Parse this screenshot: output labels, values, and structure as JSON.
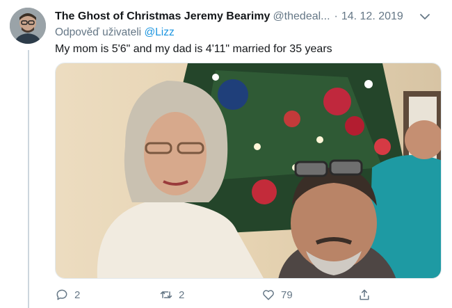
{
  "tweet": {
    "author_name": "The Ghost of Christmas Jeremy Bearimy",
    "handle": "@thedeal...",
    "separator": "·",
    "date": "14. 12. 2019",
    "reply_prefix": "Odpověď uživateli",
    "reply_to": "@Lizz",
    "text": "My mom is 5'6\" and my dad is 4'11\" married for 35 years",
    "photo_description": "Couple posing in front of a decorated Christmas tree"
  },
  "actions": {
    "reply_count": "2",
    "retweet_count": "2",
    "like_count": "79"
  },
  "colors": {
    "secondary_text": "#657786",
    "link": "#1b95e0",
    "thread_line": "#ccd6dd"
  },
  "icons": [
    "chevron-down-icon",
    "reply-icon",
    "retweet-icon",
    "like-icon",
    "share-icon"
  ]
}
